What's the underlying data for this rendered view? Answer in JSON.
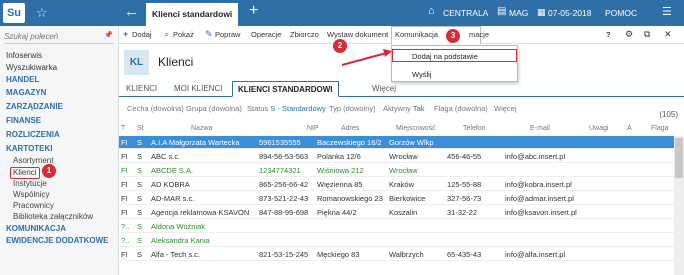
{
  "app": {
    "logo": "Su",
    "active_tab": "Klienci standardowi",
    "company": "CENTRALA",
    "warehouse": "MAG",
    "date": "07-05-2018",
    "help": "POMOC"
  },
  "sidebar": {
    "search_placeholder": "Szukaj poleceń",
    "items": [
      {
        "label": "Infoserwis",
        "type": "plain"
      },
      {
        "label": "Wyszukiwarka",
        "type": "plain"
      },
      {
        "label": "HANDEL",
        "type": "head"
      },
      {
        "label": "MAGAZYN",
        "type": "head"
      },
      {
        "label": "ZARZĄDZANIE",
        "type": "head"
      },
      {
        "label": "FINANSE",
        "type": "head"
      },
      {
        "label": "ROZLICZENIA",
        "type": "head"
      },
      {
        "label": "KARTOTEKI",
        "type": "head"
      },
      {
        "label": "Asortyment",
        "type": "sub"
      },
      {
        "label": "Klienci",
        "type": "sub-selected"
      },
      {
        "label": "Instytucje",
        "type": "sub"
      },
      {
        "label": "Wspólnicy",
        "type": "sub"
      },
      {
        "label": "Pracownicy",
        "type": "sub"
      },
      {
        "label": "Biblioteka załączników",
        "type": "sub"
      },
      {
        "label": "KOMUNIKACJA",
        "type": "head"
      },
      {
        "label": "EWIDENCJE DODATKOWE",
        "type": "head"
      }
    ]
  },
  "toolbar": {
    "add": "Dodaj",
    "show": "Pokaż",
    "edit": "Popraw",
    "operations": "Operacje",
    "collective": "Zbiorczo",
    "issue_doc": "Wystaw dokument",
    "communication": "Komunikacja",
    "more_suffix": "macje",
    "help_icon": "?"
  },
  "dropdown": {
    "items": [
      "Dodaj na podstawie",
      "Wyślij"
    ]
  },
  "badges": [
    "1",
    "2",
    "3"
  ],
  "header": {
    "badge": "KL",
    "title": "Klienci"
  },
  "tabs": [
    "KLIENCI",
    "MOI KLIENCI",
    "KLIENCI STANDARDOWI",
    "Więcej"
  ],
  "filters": {
    "cecha": "Cecha (dowolna)",
    "grupa": "Grupa (dowolna)",
    "status_label": "Status",
    "status_value": "S - Standardowy",
    "typ": "Typ (dowolny)",
    "aktywny_label": "Aktywny",
    "aktywny_value": "Tak",
    "flaga": "Flaga (dowolna)",
    "wiecej": "Więcej",
    "count": "(105)"
  },
  "columns": [
    "T",
    "St",
    "Nazwa",
    "NIP",
    "Adres",
    "Miejscowość",
    "Telefon",
    "E-mail",
    "Uwagi",
    "A",
    "Flaga"
  ],
  "rows": [
    {
      "t": "FI",
      "st": "S",
      "name": "A.I.A Małgorzata Wartecka",
      "nip": "5961535555",
      "addr": "Baczewskiego 16/2",
      "city": "Gorzów Wlkp",
      "tel": "",
      "email": "",
      "style": "sel"
    },
    {
      "t": "FI",
      "st": "S",
      "name": "ABC s.c.",
      "nip": "894-56-53-563",
      "addr": "Polanka 12/6",
      "city": "Wrocław",
      "tel": "456-46-55",
      "email": "info@abc.insert.pl",
      "style": ""
    },
    {
      "t": "FI",
      "st": "S",
      "name": "ABCDE S.A.",
      "nip": "1234774321",
      "addr": "Wiśniowa 212",
      "city": "Wrocław",
      "tel": "",
      "email": "",
      "style": "green"
    },
    {
      "t": "FI",
      "st": "S",
      "name": "AD KOBRA",
      "nip": "865-256-66-42",
      "addr": "Więzienna 85",
      "city": "Kraków",
      "tel": "125-55-88",
      "email": "info@kobra.insert.pl",
      "style": ""
    },
    {
      "t": "FI",
      "st": "S",
      "name": "AD-MAR s.c.",
      "nip": "873-521-22-43",
      "addr": "Romanowskiego 23",
      "city": "Bierkowice",
      "tel": "327-56-73",
      "email": "info@admar.insert.pl",
      "style": ""
    },
    {
      "t": "FI",
      "st": "S",
      "name": "Agencja reklamowa KSAVON",
      "nip": "847-88-99-698",
      "addr": "Piękna 44/2",
      "city": "Koszalin",
      "tel": "31-32-22",
      "email": "info@ksavon.insert.pl",
      "style": ""
    },
    {
      "t": "?..",
      "st": "S",
      "name": "Aldona Woźniak",
      "nip": "",
      "addr": "",
      "city": "",
      "tel": "",
      "email": "",
      "style": "green"
    },
    {
      "t": "?..",
      "st": "S",
      "name": "Aleksandra Kania",
      "nip": "",
      "addr": "",
      "city": "",
      "tel": "",
      "email": "",
      "style": "green"
    },
    {
      "t": "FI",
      "st": "S",
      "name": "Alfa - Tech s.c.",
      "nip": "821-53-15-245",
      "addr": "Męckiego 83",
      "city": "Wałbrzych",
      "tel": "65-435-43",
      "email": "info@alfa.insert.pl",
      "style": ""
    }
  ],
  "colors": {
    "accent": "#2f6fa8",
    "highlight": "#d72b38",
    "selected_row": "#3b8fd9",
    "green_text": "#2e8b2e"
  }
}
